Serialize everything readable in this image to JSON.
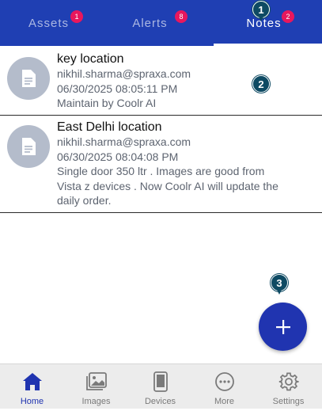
{
  "tabs": [
    {
      "label": "Assets",
      "badge": "1"
    },
    {
      "label": "Alerts",
      "badge": "8"
    },
    {
      "label": "Notes",
      "badge": "2",
      "active": true
    }
  ],
  "markers": [
    "1",
    "2",
    "3"
  ],
  "notes": [
    {
      "title": "key location",
      "email": "nikhil.sharma@spraxa.com",
      "timestamp": "06/30/2025 08:05:11 PM",
      "lines": [
        "Maintain by Coolr AI"
      ]
    },
    {
      "title": "East Delhi location",
      "email": "nikhil.sharma@spraxa.com",
      "timestamp": "06/30/2025 08:04:08 PM",
      "lines": [
        "Single door 350 ltr . Images are good from",
        "Vista z devices . Now Coolr AI will update the",
        "daily order."
      ]
    }
  ],
  "fab": {
    "icon": "plus-icon"
  },
  "bottom_nav": [
    {
      "label": "Home",
      "icon": "home-icon",
      "active": true
    },
    {
      "label": "Images",
      "icon": "images-icon"
    },
    {
      "label": "Devices",
      "icon": "device-icon"
    },
    {
      "label": "More",
      "icon": "more-icon"
    },
    {
      "label": "Settings",
      "icon": "gear-icon"
    }
  ],
  "colors": {
    "primary": "#1f3fb3",
    "badge": "#e8175d",
    "fab": "#2034b0",
    "marker": "#0e4a63",
    "avatar": "#b4bccb"
  }
}
